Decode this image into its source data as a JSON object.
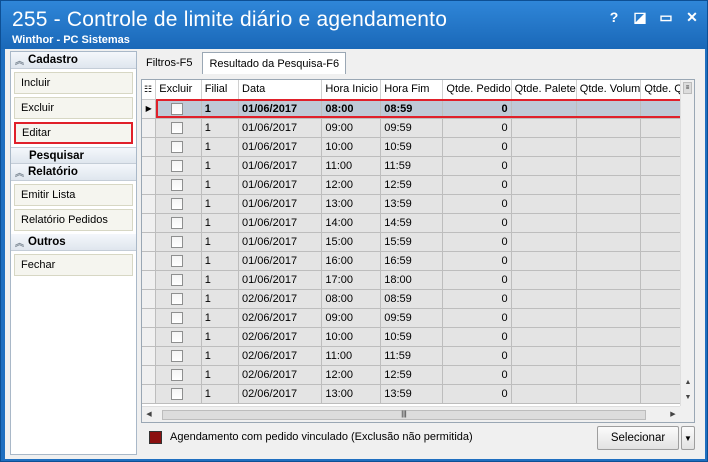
{
  "window": {
    "title": "255 - Controle de limite diário e agendamento",
    "subtitle": "Winthor - PC Sistemas",
    "buttons": [
      "?",
      "◪",
      "▭",
      "✕"
    ]
  },
  "sidebar": {
    "groups": [
      {
        "label": "Cadastro",
        "items": [
          "Incluir",
          "Excluir",
          "Editar"
        ]
      },
      {
        "label": "Pesquisar",
        "items": []
      },
      {
        "label": "Relatório",
        "items": [
          "Emitir Lista",
          "Relatório Pedidos"
        ]
      },
      {
        "label": "Outros",
        "items": [
          "Fechar"
        ]
      }
    ]
  },
  "tabs": [
    "Filtros-F5",
    "Resultado da Pesquisa-F6"
  ],
  "grid": {
    "columns": [
      "Excluir",
      "Filial",
      "Data",
      "Hora Inicio",
      "Hora Fim",
      "Qtde. Pedido",
      "Qtde. Palete",
      "Qtde. Volum",
      "Qtde. Qu"
    ],
    "rows": [
      [
        "1",
        "01/06/2017",
        "08:00",
        "08:59",
        "0"
      ],
      [
        "1",
        "01/06/2017",
        "09:00",
        "09:59",
        "0"
      ],
      [
        "1",
        "01/06/2017",
        "10:00",
        "10:59",
        "0"
      ],
      [
        "1",
        "01/06/2017",
        "11:00",
        "11:59",
        "0"
      ],
      [
        "1",
        "01/06/2017",
        "12:00",
        "12:59",
        "0"
      ],
      [
        "1",
        "01/06/2017",
        "13:00",
        "13:59",
        "0"
      ],
      [
        "1",
        "01/06/2017",
        "14:00",
        "14:59",
        "0"
      ],
      [
        "1",
        "01/06/2017",
        "15:00",
        "15:59",
        "0"
      ],
      [
        "1",
        "01/06/2017",
        "16:00",
        "16:59",
        "0"
      ],
      [
        "1",
        "01/06/2017",
        "17:00",
        "18:00",
        "0"
      ],
      [
        "1",
        "02/06/2017",
        "08:00",
        "08:59",
        "0"
      ],
      [
        "1",
        "02/06/2017",
        "09:00",
        "09:59",
        "0"
      ],
      [
        "1",
        "02/06/2017",
        "10:00",
        "10:59",
        "0"
      ],
      [
        "1",
        "02/06/2017",
        "11:00",
        "11:59",
        "0"
      ],
      [
        "1",
        "02/06/2017",
        "12:00",
        "12:59",
        "0"
      ],
      [
        "1",
        "02/06/2017",
        "13:00",
        "13:59",
        "0"
      ]
    ]
  },
  "legend": {
    "text": "Agendamento com pedido vinculado (Exclusão não permitida)",
    "color": "#8b1010"
  },
  "select_button": "Selecionar",
  "colors": {
    "title_bar": "#1f6fc0",
    "highlight": "#e0202a",
    "selected_row": "#bfc9d6"
  }
}
